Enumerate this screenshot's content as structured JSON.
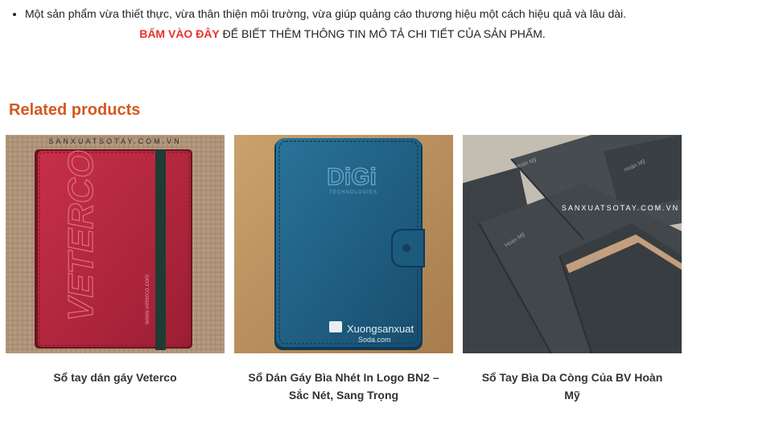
{
  "description": {
    "bullet": "Một sản phẩm vừa thiết thực, vừa thân thiện môi trường, vừa giúp quảng cáo thương hiệu một cách hiệu quả và lâu dài.",
    "cta_link": "BẤM VÀO ĐÂY",
    "cta_text": " ĐỂ BIẾT THÊM THÔNG TIN MÔ TẢ CHI TIẾT CỦA SẢN PHẨM."
  },
  "related": {
    "title": "Related products",
    "products": [
      {
        "name": "Sổ tay dán gáy Veterco",
        "image_watermark": "SANXUATSOTAY.COM.VN",
        "logo": "VETERCO",
        "sublogo": "www.veterco.com",
        "cover_color": "#b8283c"
      },
      {
        "name": "Sổ Dán Gáy Bìa Nhét In Logo BN2 – Sắc Nét, Sang Trọng",
        "logo": "DiGi",
        "sublogo": "TECHNOLOGIES",
        "watermark_1": "Xuongsanxuat",
        "watermark_2": "Soda.com",
        "cover_color": "#1f5f85"
      },
      {
        "name": "Sổ Tay Bìa Da Còng Của BV Hoàn Mỹ",
        "image_watermark": "SANXUATSOTAY.COM.VN",
        "logo": "Hoàn Mỹ",
        "cover_color": "#3f4447"
      }
    ]
  }
}
